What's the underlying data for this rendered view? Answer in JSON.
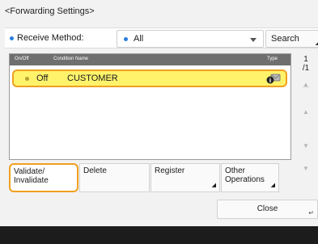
{
  "title": "<Forwarding Settings>",
  "receive": {
    "label": "Receive Method:",
    "selected": "All",
    "search_label": "Search"
  },
  "list": {
    "headers": {
      "onoff": "On/Off",
      "condition": "Condition Name",
      "type": "Type"
    },
    "rows": [
      {
        "onoff": "Off",
        "name": "CUSTOMER",
        "type_icon": "forward-type-icon"
      }
    ]
  },
  "pager": {
    "current": "1",
    "total": "/1"
  },
  "buttons": {
    "validate": "Validate/ Invalidate",
    "delete": "Delete",
    "register": "Register",
    "other": "Other Operations",
    "close": "Close"
  },
  "colors": {
    "accent": "#2a7de1",
    "selection": "#fff36b",
    "highlight_border": "#f0a020"
  }
}
